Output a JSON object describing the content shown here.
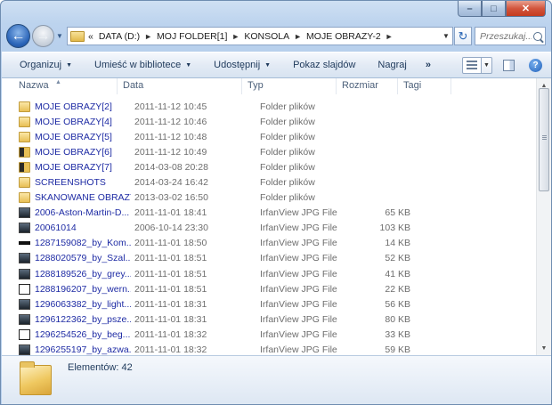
{
  "window": {
    "caption": {
      "minimize": "–",
      "maximize": "□",
      "close": "✕"
    }
  },
  "nav": {
    "back_symbol": "←",
    "forward_symbol": "→",
    "breadcrumb_overflow": "«",
    "breadcrumbs": [
      "DATA (D:)",
      "MOJ FOLDER[1]",
      "KONSOLA",
      "MOJE OBRAZY-2"
    ],
    "search_placeholder": "Przeszukaj..."
  },
  "toolbar": {
    "organize": "Organizuj",
    "include_library": "Umieść w bibliotece",
    "share": "Udostępnij",
    "slideshow": "Pokaz slajdów",
    "burn": "Nagraj",
    "more": "»"
  },
  "columns": {
    "name": "Nazwa",
    "date": "Data",
    "type": "Typ",
    "size": "Rozmiar",
    "tags": "Tagi"
  },
  "files": [
    {
      "name": "MOJE OBRAZY[2]",
      "date": "2011-11-12 10:45",
      "type": "Folder plików",
      "size": "",
      "icon": "folder"
    },
    {
      "name": "MOJE OBRAZY[4]",
      "date": "2011-11-12 10:46",
      "type": "Folder plików",
      "size": "",
      "icon": "folder"
    },
    {
      "name": "MOJE OBRAZY[5]",
      "date": "2011-11-12 10:48",
      "type": "Folder plików",
      "size": "",
      "icon": "folder"
    },
    {
      "name": "MOJE OBRAZY[6]",
      "date": "2011-11-12 10:49",
      "type": "Folder plików",
      "size": "",
      "icon": "folder-dark"
    },
    {
      "name": "MOJE OBRAZY[7]",
      "date": "2014-03-08 20:28",
      "type": "Folder plików",
      "size": "",
      "icon": "folder-dark"
    },
    {
      "name": "SCREENSHOTS",
      "date": "2014-03-24 16:42",
      "type": "Folder plików",
      "size": "",
      "icon": "folder"
    },
    {
      "name": "SKANOWANE OBRAZY",
      "date": "2013-03-02 16:50",
      "type": "Folder plików",
      "size": "",
      "icon": "folder"
    },
    {
      "name": "2006-Aston-Martin-D...",
      "date": "2011-11-01 18:41",
      "type": "IrfanView JPG File",
      "size": "65 KB",
      "icon": "image"
    },
    {
      "name": "20061014",
      "date": "2006-10-14 23:30",
      "type": "IrfanView JPG File",
      "size": "103 KB",
      "icon": "image"
    },
    {
      "name": "1287159082_by_Kom...",
      "date": "2011-11-01 18:50",
      "type": "IrfanView JPG File",
      "size": "14 KB",
      "icon": "image-bar"
    },
    {
      "name": "1288020579_by_Szal...",
      "date": "2011-11-01 18:51",
      "type": "IrfanView JPG File",
      "size": "52 KB",
      "icon": "image"
    },
    {
      "name": "1288189526_by_grey...",
      "date": "2011-11-01 18:51",
      "type": "IrfanView JPG File",
      "size": "41 KB",
      "icon": "image"
    },
    {
      "name": "1288196207_by_wern...",
      "date": "2011-11-01 18:51",
      "type": "IrfanView JPG File",
      "size": "22 KB",
      "icon": "image-light"
    },
    {
      "name": "1296063382_by_light...",
      "date": "2011-11-01 18:31",
      "type": "IrfanView JPG File",
      "size": "56 KB",
      "icon": "image"
    },
    {
      "name": "1296122362_by_psze...",
      "date": "2011-11-01 18:31",
      "type": "IrfanView JPG File",
      "size": "80 KB",
      "icon": "image"
    },
    {
      "name": "1296254526_by_beg...",
      "date": "2011-11-01 18:32",
      "type": "IrfanView JPG File",
      "size": "33 KB",
      "icon": "image-light"
    },
    {
      "name": "1296255197_by_azwa...",
      "date": "2011-11-01 18:32",
      "type": "IrfanView JPG File",
      "size": "59 KB",
      "icon": "image"
    }
  ],
  "status": {
    "items_count": "Elementów: 42"
  },
  "colors": {
    "frame": "#b7cfec",
    "link_text": "#1e2ba4",
    "toolbar_text": "#1e395b"
  }
}
